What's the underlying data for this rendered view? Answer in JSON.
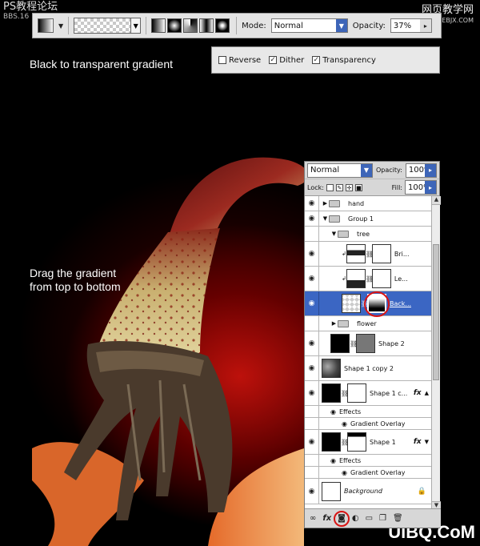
{
  "watermarks": {
    "top_left": "PS教程论坛",
    "top_left_sub": "BBS.16",
    "top_right": "网页教学网",
    "top_right_sub": "WWW.WEBJX.COM",
    "bottom_right": "UiBQ.CoM"
  },
  "options_bar": {
    "mode_label": "Mode:",
    "mode_value": "Normal",
    "opacity_label": "Opacity:",
    "opacity_value": "37%"
  },
  "checkboxes": [
    {
      "label": "Reverse",
      "checked": false
    },
    {
      "label": "Dither",
      "checked": true
    },
    {
      "label": "Transparency",
      "checked": true
    }
  ],
  "captions": {
    "gradient": "Black to transparent gradient",
    "drag_line1": "Drag the gradient",
    "drag_line2": "from top to bottom"
  },
  "layers_panel": {
    "blend_mode": "Normal",
    "opacity_label": "Opacity:",
    "opacity_value": "100%",
    "lock_label": "Lock:",
    "fill_label": "Fill:",
    "fill_value": "100%",
    "layers": [
      {
        "name": "hand",
        "kind": "group"
      },
      {
        "name": "Group 1",
        "kind": "group"
      },
      {
        "name": "tree",
        "kind": "group"
      },
      {
        "name": "Bri...",
        "kind": "adjustment"
      },
      {
        "name": "Le...",
        "kind": "adjustment"
      },
      {
        "name": "Back...",
        "kind": "layer",
        "selected": true
      },
      {
        "name": "flower",
        "kind": "group"
      },
      {
        "name": "Shape 2",
        "kind": "shape"
      },
      {
        "name": "Shape 1 copy 2",
        "kind": "layer"
      },
      {
        "name": "Shape 1 c...",
        "kind": "shape",
        "fx": "fx"
      },
      {
        "name": "Effects",
        "kind": "effects"
      },
      {
        "name": "Gradient Overlay",
        "kind": "effect"
      },
      {
        "name": "Shape 1",
        "kind": "shape",
        "fx": "fx"
      },
      {
        "name": "Effects",
        "kind": "effects"
      },
      {
        "name": "Gradient Overlay",
        "kind": "effect"
      },
      {
        "name": "Background",
        "kind": "background"
      }
    ]
  },
  "colors": {
    "selection": "#3b66c3",
    "highlight_circle": "#d81414",
    "glow": "#c4120c"
  }
}
